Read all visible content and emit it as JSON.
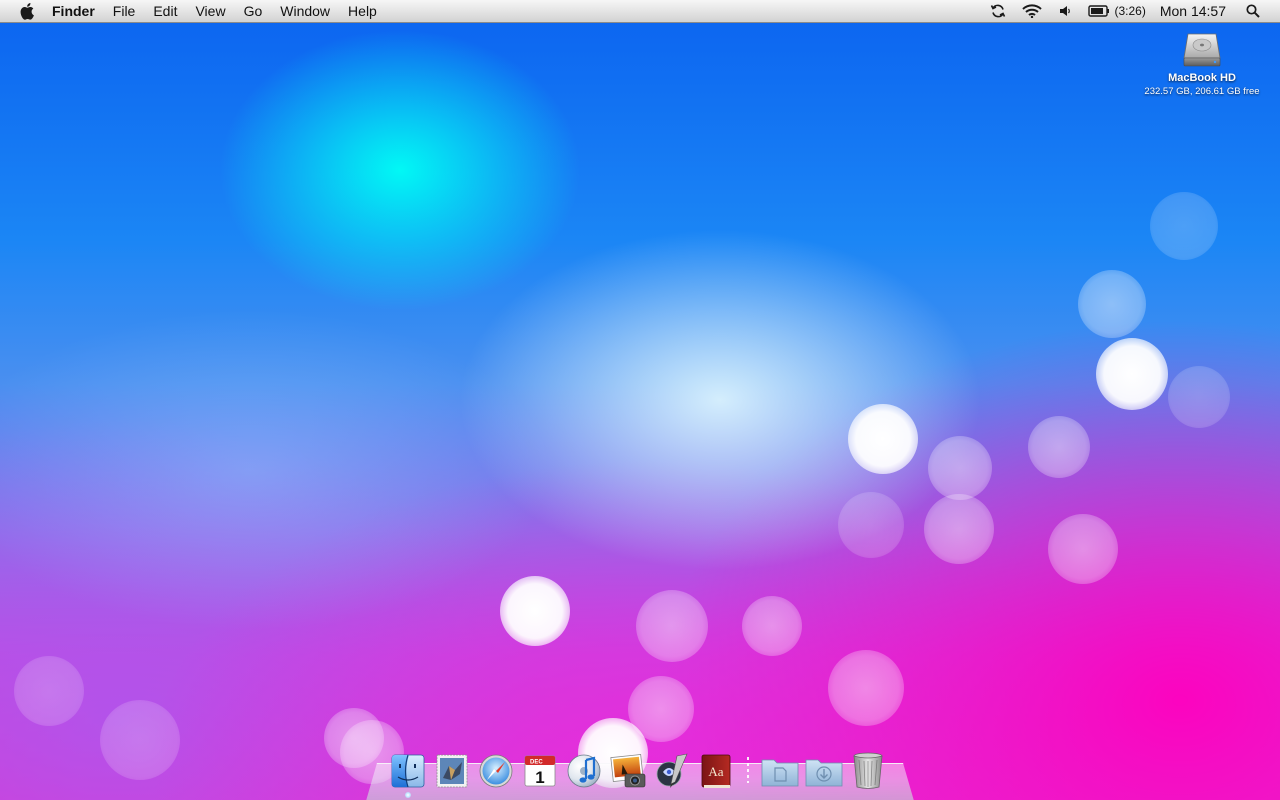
{
  "menubar": {
    "apple_icon": "apple-logo-icon",
    "app_name": "Finder",
    "menus": [
      "File",
      "Edit",
      "View",
      "Go",
      "Window",
      "Help"
    ],
    "status": {
      "sync_icon": "time-machine-sync-icon",
      "wifi_icon": "wifi-icon",
      "volume_icon": "volume-icon",
      "battery_icon": "battery-icon",
      "battery_time": "(3:26)",
      "clock": "Mon 14:57",
      "spotlight_icon": "spotlight-search-icon"
    }
  },
  "desktop": {
    "drive": {
      "icon": "hard-drive-icon",
      "name": "MacBook HD",
      "info": "232.57 GB, 206.61 GB free"
    }
  },
  "dock": {
    "apps": [
      {
        "name": "Finder",
        "icon": "finder-icon",
        "running": true
      },
      {
        "name": "Mail",
        "icon": "mail-icon",
        "running": false
      },
      {
        "name": "Safari",
        "icon": "safari-icon",
        "running": false
      },
      {
        "name": "iCal",
        "icon": "ical-icon",
        "month": "DEC",
        "day": "1",
        "running": false
      },
      {
        "name": "iTunes",
        "icon": "itunes-icon",
        "running": false
      },
      {
        "name": "iPhoto",
        "icon": "iphoto-icon",
        "running": false
      },
      {
        "name": "Preview",
        "icon": "preview-icon",
        "running": false
      },
      {
        "name": "Dictionary",
        "icon": "dictionary-icon",
        "glyph": "Aa",
        "running": false
      }
    ],
    "stacks": [
      {
        "name": "Documents",
        "icon": "documents-folder-icon"
      },
      {
        "name": "Downloads",
        "icon": "downloads-folder-icon"
      },
      {
        "name": "Trash",
        "icon": "trash-icon"
      }
    ]
  },
  "colors": {
    "menubar_top": "#f6f6f6",
    "menubar_bottom": "#d2d2d2",
    "wallpaper_blue": "#1b86f5",
    "wallpaper_magenta": "#d839d5"
  }
}
